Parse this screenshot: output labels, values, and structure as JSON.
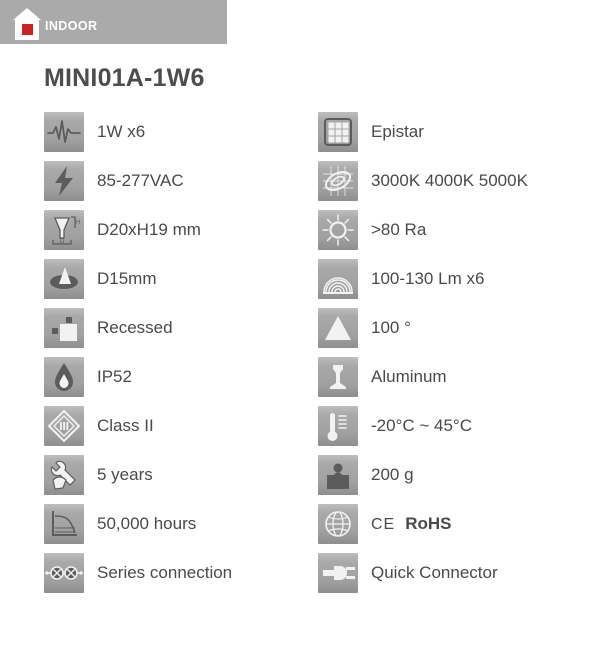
{
  "banner": {
    "label": "INDOOR",
    "icon": "house-icon",
    "bg_color": "#aaaaaa",
    "accent_color": "#cc2222"
  },
  "product": {
    "title": "MINI01A-1W6"
  },
  "specs": {
    "left": [
      {
        "icon": "waveform-power-icon",
        "value": "1W x6"
      },
      {
        "icon": "lightning-bolt-icon",
        "value": "85-277VAC"
      },
      {
        "icon": "dimensions-icon",
        "value": "D20xH19 mm"
      },
      {
        "icon": "cutout-hole-icon",
        "value": "D15mm"
      },
      {
        "icon": "recessed-mount-icon",
        "value": "Recessed"
      },
      {
        "icon": "water-drop-icon",
        "value": "IP52"
      },
      {
        "icon": "class-two-diamond-icon",
        "value": "Class II"
      },
      {
        "icon": "warranty-wrench-icon",
        "value": "5 years"
      },
      {
        "icon": "lifetime-graph-icon",
        "value": "50,000 hours"
      },
      {
        "icon": "series-connection-icon",
        "value": "Series connection"
      }
    ],
    "right": [
      {
        "icon": "led-chip-grid-icon",
        "value": "Epistar"
      },
      {
        "icon": "color-temperature-icon",
        "value": "3000K 4000K 5000K"
      },
      {
        "icon": "sun-cri-icon",
        "value": ">80 Ra"
      },
      {
        "icon": "luminous-flux-icon",
        "value": "100-130 Lm x6"
      },
      {
        "icon": "beam-angle-icon",
        "value": "100 °"
      },
      {
        "icon": "aluminum-housing-icon",
        "value": "Aluminum"
      },
      {
        "icon": "thermometer-icon",
        "value": "-20°C ~ 45°C"
      },
      {
        "icon": "weight-icon",
        "value": "200 g"
      },
      {
        "icon": "globe-certification-icon",
        "value": "",
        "ce": "CE",
        "rohs": "RoHS"
      },
      {
        "icon": "quick-connector-icon",
        "value": "Quick Connector"
      }
    ]
  },
  "colors": {
    "tile_gray": "#a9a9a9",
    "glyph_dark": "#595959",
    "text_gray": "#4a4a4a",
    "title_gray": "#4d4d4d"
  }
}
